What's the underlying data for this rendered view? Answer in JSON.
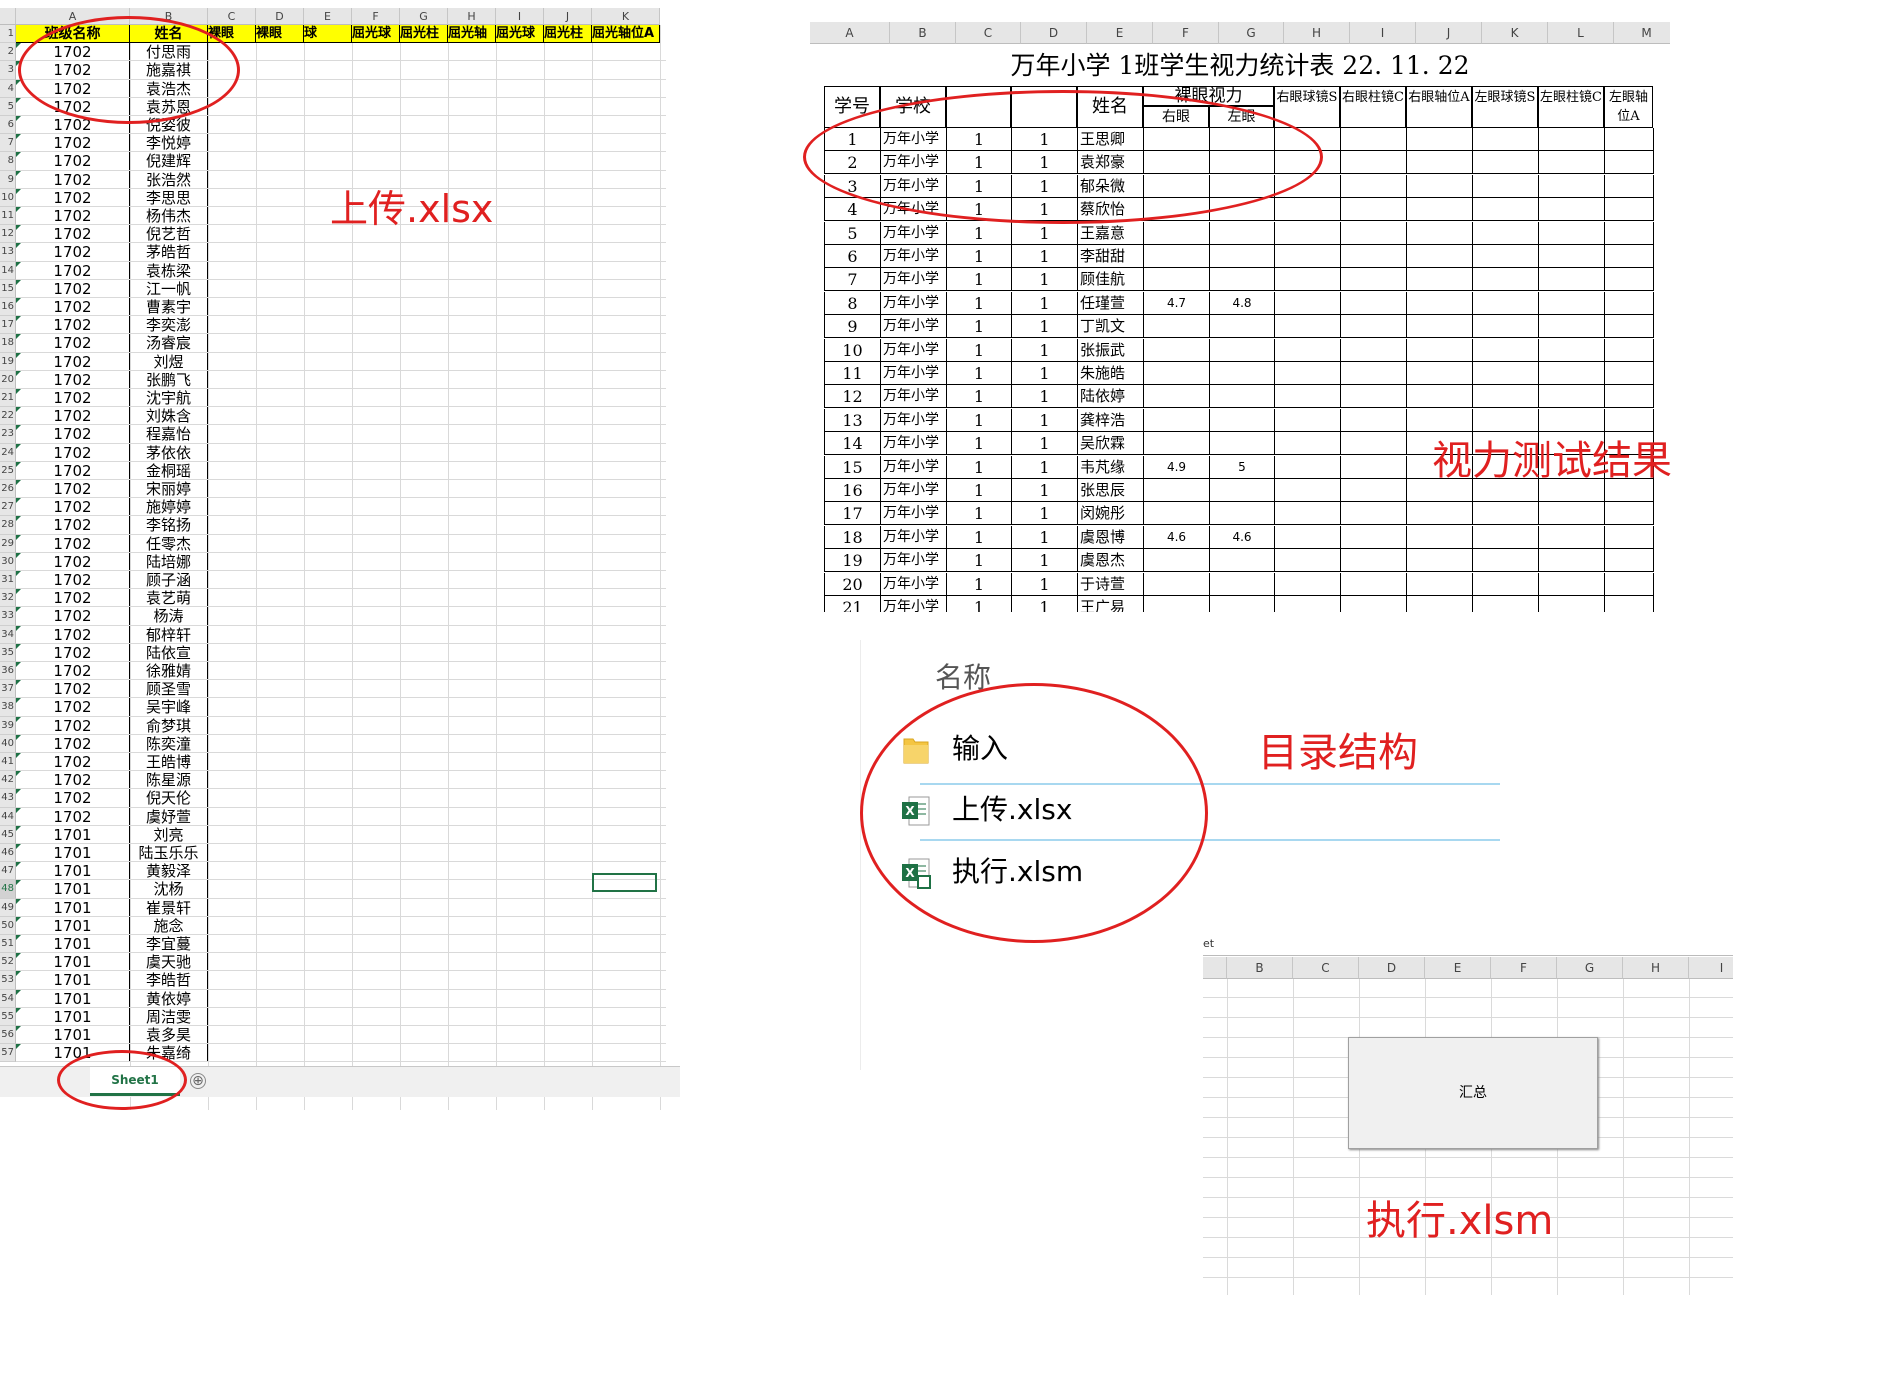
{
  "sheet1": {
    "col_headers": [
      "A",
      "B",
      "C",
      "D",
      "E",
      "F",
      "G",
      "H",
      "I",
      "J",
      "K"
    ],
    "header_row": [
      "班级名称",
      "姓名",
      "裸眼",
      "裸眼",
      "球",
      "屈光球",
      "屈光柱",
      "屈光轴",
      "屈光球",
      "屈光柱",
      "屈光轴位A"
    ],
    "rows": [
      [
        "1702",
        "付思雨"
      ],
      [
        "1702",
        "施嘉祺"
      ],
      [
        "1702",
        "袁浩杰"
      ],
      [
        "1702",
        "袁苏恩"
      ],
      [
        "1702",
        "倪姿彼"
      ],
      [
        "1702",
        "李悦婷"
      ],
      [
        "1702",
        "倪建辉"
      ],
      [
        "1702",
        "张浩然"
      ],
      [
        "1702",
        "李思思"
      ],
      [
        "1702",
        "杨伟杰"
      ],
      [
        "1702",
        "倪艺哲"
      ],
      [
        "1702",
        "茅皓哲"
      ],
      [
        "1702",
        "袁栋梁"
      ],
      [
        "1702",
        "江一帆"
      ],
      [
        "1702",
        "曹素宇"
      ],
      [
        "1702",
        "李奕澎"
      ],
      [
        "1702",
        "汤睿宸"
      ],
      [
        "1702",
        "刘煜"
      ],
      [
        "1702",
        "张鹏飞"
      ],
      [
        "1702",
        "沈宇航"
      ],
      [
        "1702",
        "刘姝含"
      ],
      [
        "1702",
        "程嘉怡"
      ],
      [
        "1702",
        "茅依依"
      ],
      [
        "1702",
        "金桐瑶"
      ],
      [
        "1702",
        "宋丽婷"
      ],
      [
        "1702",
        "施婷婷"
      ],
      [
        "1702",
        "李铭扬"
      ],
      [
        "1702",
        "任零杰"
      ],
      [
        "1702",
        "陆培娜"
      ],
      [
        "1702",
        "顾子涵"
      ],
      [
        "1702",
        "袁艺萌"
      ],
      [
        "1702",
        "杨涛"
      ],
      [
        "1702",
        "郁梓轩"
      ],
      [
        "1702",
        "陆依宣"
      ],
      [
        "1702",
        "徐雅婧"
      ],
      [
        "1702",
        "顾圣雪"
      ],
      [
        "1702",
        "吴宇峰"
      ],
      [
        "1702",
        "俞梦琪"
      ],
      [
        "1702",
        "陈奕潼"
      ],
      [
        "1702",
        "王皓博"
      ],
      [
        "1702",
        "陈星源"
      ],
      [
        "1702",
        "倪天伦"
      ],
      [
        "1702",
        "虞妤萱"
      ],
      [
        "1701",
        "刘亮"
      ],
      [
        "1701",
        "陆玉乐乐"
      ],
      [
        "1701",
        "黄毅泽"
      ],
      [
        "1701",
        "沈杨"
      ],
      [
        "1701",
        "崔景轩"
      ],
      [
        "1701",
        "施念"
      ],
      [
        "1701",
        "李宜蔓"
      ],
      [
        "1701",
        "虞天驰"
      ],
      [
        "1701",
        "李皓哲"
      ],
      [
        "1701",
        "黄依婷"
      ],
      [
        "1701",
        "周洁雯"
      ],
      [
        "1701",
        "袁多昊"
      ],
      [
        "1701",
        "朱嘉绮"
      ]
    ],
    "tab": "Sheet1",
    "add_sheet": "⊕"
  },
  "sheet2": {
    "col_headers": [
      "A",
      "B",
      "C",
      "D",
      "E",
      "F",
      "G",
      "H",
      "I",
      "J",
      "K",
      "L",
      "M"
    ],
    "title": "万年小学  1班学生视力统计表      22. 11. 22",
    "headers": {
      "xuehao": "学号",
      "school": "学校",
      "name": "姓名",
      "naked_group": "裸眼视力",
      "right_eye": "右眼",
      "left_eye": "左眼",
      "h": "右眼球镜S",
      "i": "右眼柱镜C",
      "j": "右眼轴位A",
      "k": "左眼球镜S",
      "l": "左眼柱镜C",
      "m": "左眼轴位A"
    },
    "rows": [
      [
        "1",
        "万年小学",
        "1",
        "1",
        "王思卿",
        "",
        ""
      ],
      [
        "2",
        "万年小学",
        "1",
        "1",
        "袁郑豪",
        "",
        ""
      ],
      [
        "3",
        "万年小学",
        "1",
        "1",
        "郁朵微",
        "",
        ""
      ],
      [
        "4",
        "万年小学",
        "1",
        "1",
        "蔡欣怡",
        "",
        ""
      ],
      [
        "5",
        "万年小学",
        "1",
        "1",
        "王嘉意",
        "",
        ""
      ],
      [
        "6",
        "万年小学",
        "1",
        "1",
        "李甜甜",
        "",
        ""
      ],
      [
        "7",
        "万年小学",
        "1",
        "1",
        "顾佳航",
        "",
        ""
      ],
      [
        "8",
        "万年小学",
        "1",
        "1",
        "任瑾萱",
        "4.7",
        "4.8"
      ],
      [
        "9",
        "万年小学",
        "1",
        "1",
        "丁凯文",
        "",
        ""
      ],
      [
        "10",
        "万年小学",
        "1",
        "1",
        "张振武",
        "",
        ""
      ],
      [
        "11",
        "万年小学",
        "1",
        "1",
        "朱施皓",
        "",
        ""
      ],
      [
        "12",
        "万年小学",
        "1",
        "1",
        "陆依婷",
        "",
        ""
      ],
      [
        "13",
        "万年小学",
        "1",
        "1",
        "龚梓浩",
        "",
        ""
      ],
      [
        "14",
        "万年小学",
        "1",
        "1",
        "吴欣霖",
        "",
        ""
      ],
      [
        "15",
        "万年小学",
        "1",
        "1",
        "韦芃缘",
        "4.9",
        "5"
      ],
      [
        "16",
        "万年小学",
        "1",
        "1",
        "张思辰",
        "",
        ""
      ],
      [
        "17",
        "万年小学",
        "1",
        "1",
        "闵婉彤",
        "",
        ""
      ],
      [
        "18",
        "万年小学",
        "1",
        "1",
        "虞恩博",
        "4.6",
        "4.6"
      ],
      [
        "19",
        "万年小学",
        "1",
        "1",
        "虞恩杰",
        "",
        ""
      ],
      [
        "20",
        "万年小学",
        "1",
        "1",
        "于诗萱",
        "",
        ""
      ],
      [
        "21",
        "万年小学",
        "1",
        "1",
        "王广易",
        "",
        ""
      ]
    ]
  },
  "folder": {
    "header": "名称",
    "items": [
      {
        "name": "输入",
        "icon": "folder-icon"
      },
      {
        "name": "上传.xlsx",
        "icon": "excel-file-icon"
      },
      {
        "name": "执行.xlsm",
        "icon": "excel-macro-file-icon"
      }
    ]
  },
  "sheet3": {
    "sheet_fragment": "et",
    "col_headers": [
      "B",
      "C",
      "D",
      "E",
      "F",
      "G",
      "H",
      "I"
    ],
    "button_label": "汇总"
  },
  "annotations": {
    "upload_label": "上传.xlsx",
    "result_label": "视力测试结果",
    "dir_label": "目录结构",
    "exec_label": "执行.xlsm"
  },
  "colors": {
    "annotation_red": "#e02020",
    "excel_green": "#217346",
    "header_yellow": "#ffff00"
  }
}
